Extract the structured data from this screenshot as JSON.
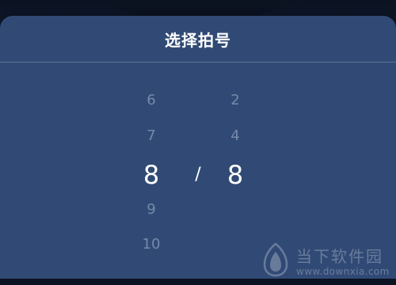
{
  "header": {
    "title": "选择拍号"
  },
  "picker": {
    "left_column": {
      "items": [
        "6",
        "7",
        "8",
        "9",
        "10"
      ],
      "selected": "8"
    },
    "separator": "/",
    "right_column": {
      "items": [
        "2",
        "4",
        "8"
      ],
      "selected": "8"
    }
  },
  "watermark": {
    "title": "当下软件园",
    "url": "www.downxia.com"
  },
  "colors": {
    "sheet_background": "#314a75",
    "selected_text": "#ffffff",
    "unselected_text": "#c9d4e8",
    "background": "#0d1424"
  }
}
